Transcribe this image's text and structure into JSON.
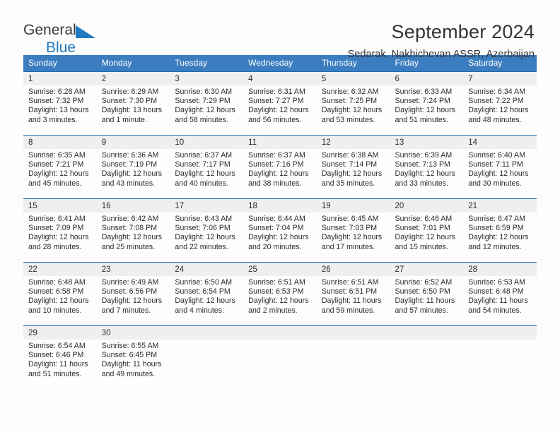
{
  "brand": {
    "name_top": "General",
    "name_bottom": "Blue",
    "triangle_color": "#1f7ac0",
    "top_color": "#3b3b3b"
  },
  "header": {
    "title": "September 2024",
    "subtitle": "Sedarak, Nakhichevan ASSR, Azerbaijan"
  },
  "theme": {
    "header_bg": "#3b7dbf",
    "row_divider": "#1f6bb0",
    "daynum_bg": "#efefef"
  },
  "weekdays": [
    "Sunday",
    "Monday",
    "Tuesday",
    "Wednesday",
    "Thursday",
    "Friday",
    "Saturday"
  ],
  "weeks": [
    [
      {
        "day": "1",
        "sunrise": "Sunrise: 6:28 AM",
        "sunset": "Sunset: 7:32 PM",
        "daylight_1": "Daylight: 13 hours",
        "daylight_2": "and 3 minutes."
      },
      {
        "day": "2",
        "sunrise": "Sunrise: 6:29 AM",
        "sunset": "Sunset: 7:30 PM",
        "daylight_1": "Daylight: 13 hours",
        "daylight_2": "and 1 minute."
      },
      {
        "day": "3",
        "sunrise": "Sunrise: 6:30 AM",
        "sunset": "Sunset: 7:29 PM",
        "daylight_1": "Daylight: 12 hours",
        "daylight_2": "and 58 minutes."
      },
      {
        "day": "4",
        "sunrise": "Sunrise: 6:31 AM",
        "sunset": "Sunset: 7:27 PM",
        "daylight_1": "Daylight: 12 hours",
        "daylight_2": "and 56 minutes."
      },
      {
        "day": "5",
        "sunrise": "Sunrise: 6:32 AM",
        "sunset": "Sunset: 7:25 PM",
        "daylight_1": "Daylight: 12 hours",
        "daylight_2": "and 53 minutes."
      },
      {
        "day": "6",
        "sunrise": "Sunrise: 6:33 AM",
        "sunset": "Sunset: 7:24 PM",
        "daylight_1": "Daylight: 12 hours",
        "daylight_2": "and 51 minutes."
      },
      {
        "day": "7",
        "sunrise": "Sunrise: 6:34 AM",
        "sunset": "Sunset: 7:22 PM",
        "daylight_1": "Daylight: 12 hours",
        "daylight_2": "and 48 minutes."
      }
    ],
    [
      {
        "day": "8",
        "sunrise": "Sunrise: 6:35 AM",
        "sunset": "Sunset: 7:21 PM",
        "daylight_1": "Daylight: 12 hours",
        "daylight_2": "and 45 minutes."
      },
      {
        "day": "9",
        "sunrise": "Sunrise: 6:36 AM",
        "sunset": "Sunset: 7:19 PM",
        "daylight_1": "Daylight: 12 hours",
        "daylight_2": "and 43 minutes."
      },
      {
        "day": "10",
        "sunrise": "Sunrise: 6:37 AM",
        "sunset": "Sunset: 7:17 PM",
        "daylight_1": "Daylight: 12 hours",
        "daylight_2": "and 40 minutes."
      },
      {
        "day": "11",
        "sunrise": "Sunrise: 6:37 AM",
        "sunset": "Sunset: 7:16 PM",
        "daylight_1": "Daylight: 12 hours",
        "daylight_2": "and 38 minutes."
      },
      {
        "day": "12",
        "sunrise": "Sunrise: 6:38 AM",
        "sunset": "Sunset: 7:14 PM",
        "daylight_1": "Daylight: 12 hours",
        "daylight_2": "and 35 minutes."
      },
      {
        "day": "13",
        "sunrise": "Sunrise: 6:39 AM",
        "sunset": "Sunset: 7:13 PM",
        "daylight_1": "Daylight: 12 hours",
        "daylight_2": "and 33 minutes."
      },
      {
        "day": "14",
        "sunrise": "Sunrise: 6:40 AM",
        "sunset": "Sunset: 7:11 PM",
        "daylight_1": "Daylight: 12 hours",
        "daylight_2": "and 30 minutes."
      }
    ],
    [
      {
        "day": "15",
        "sunrise": "Sunrise: 6:41 AM",
        "sunset": "Sunset: 7:09 PM",
        "daylight_1": "Daylight: 12 hours",
        "daylight_2": "and 28 minutes."
      },
      {
        "day": "16",
        "sunrise": "Sunrise: 6:42 AM",
        "sunset": "Sunset: 7:08 PM",
        "daylight_1": "Daylight: 12 hours",
        "daylight_2": "and 25 minutes."
      },
      {
        "day": "17",
        "sunrise": "Sunrise: 6:43 AM",
        "sunset": "Sunset: 7:06 PM",
        "daylight_1": "Daylight: 12 hours",
        "daylight_2": "and 22 minutes."
      },
      {
        "day": "18",
        "sunrise": "Sunrise: 6:44 AM",
        "sunset": "Sunset: 7:04 PM",
        "daylight_1": "Daylight: 12 hours",
        "daylight_2": "and 20 minutes."
      },
      {
        "day": "19",
        "sunrise": "Sunrise: 6:45 AM",
        "sunset": "Sunset: 7:03 PM",
        "daylight_1": "Daylight: 12 hours",
        "daylight_2": "and 17 minutes."
      },
      {
        "day": "20",
        "sunrise": "Sunrise: 6:46 AM",
        "sunset": "Sunset: 7:01 PM",
        "daylight_1": "Daylight: 12 hours",
        "daylight_2": "and 15 minutes."
      },
      {
        "day": "21",
        "sunrise": "Sunrise: 6:47 AM",
        "sunset": "Sunset: 6:59 PM",
        "daylight_1": "Daylight: 12 hours",
        "daylight_2": "and 12 minutes."
      }
    ],
    [
      {
        "day": "22",
        "sunrise": "Sunrise: 6:48 AM",
        "sunset": "Sunset: 6:58 PM",
        "daylight_1": "Daylight: 12 hours",
        "daylight_2": "and 10 minutes."
      },
      {
        "day": "23",
        "sunrise": "Sunrise: 6:49 AM",
        "sunset": "Sunset: 6:56 PM",
        "daylight_1": "Daylight: 12 hours",
        "daylight_2": "and 7 minutes."
      },
      {
        "day": "24",
        "sunrise": "Sunrise: 6:50 AM",
        "sunset": "Sunset: 6:54 PM",
        "daylight_1": "Daylight: 12 hours",
        "daylight_2": "and 4 minutes."
      },
      {
        "day": "25",
        "sunrise": "Sunrise: 6:51 AM",
        "sunset": "Sunset: 6:53 PM",
        "daylight_1": "Daylight: 12 hours",
        "daylight_2": "and 2 minutes."
      },
      {
        "day": "26",
        "sunrise": "Sunrise: 6:51 AM",
        "sunset": "Sunset: 6:51 PM",
        "daylight_1": "Daylight: 11 hours",
        "daylight_2": "and 59 minutes."
      },
      {
        "day": "27",
        "sunrise": "Sunrise: 6:52 AM",
        "sunset": "Sunset: 6:50 PM",
        "daylight_1": "Daylight: 11 hours",
        "daylight_2": "and 57 minutes."
      },
      {
        "day": "28",
        "sunrise": "Sunrise: 6:53 AM",
        "sunset": "Sunset: 6:48 PM",
        "daylight_1": "Daylight: 11 hours",
        "daylight_2": "and 54 minutes."
      }
    ],
    [
      {
        "day": "29",
        "sunrise": "Sunrise: 6:54 AM",
        "sunset": "Sunset: 6:46 PM",
        "daylight_1": "Daylight: 11 hours",
        "daylight_2": "and 51 minutes."
      },
      {
        "day": "30",
        "sunrise": "Sunrise: 6:55 AM",
        "sunset": "Sunset: 6:45 PM",
        "daylight_1": "Daylight: 11 hours",
        "daylight_2": "and 49 minutes."
      },
      {
        "day": "",
        "sunrise": "",
        "sunset": "",
        "daylight_1": "",
        "daylight_2": ""
      },
      {
        "day": "",
        "sunrise": "",
        "sunset": "",
        "daylight_1": "",
        "daylight_2": ""
      },
      {
        "day": "",
        "sunrise": "",
        "sunset": "",
        "daylight_1": "",
        "daylight_2": ""
      },
      {
        "day": "",
        "sunrise": "",
        "sunset": "",
        "daylight_1": "",
        "daylight_2": ""
      },
      {
        "day": "",
        "sunrise": "",
        "sunset": "",
        "daylight_1": "",
        "daylight_2": ""
      }
    ]
  ]
}
